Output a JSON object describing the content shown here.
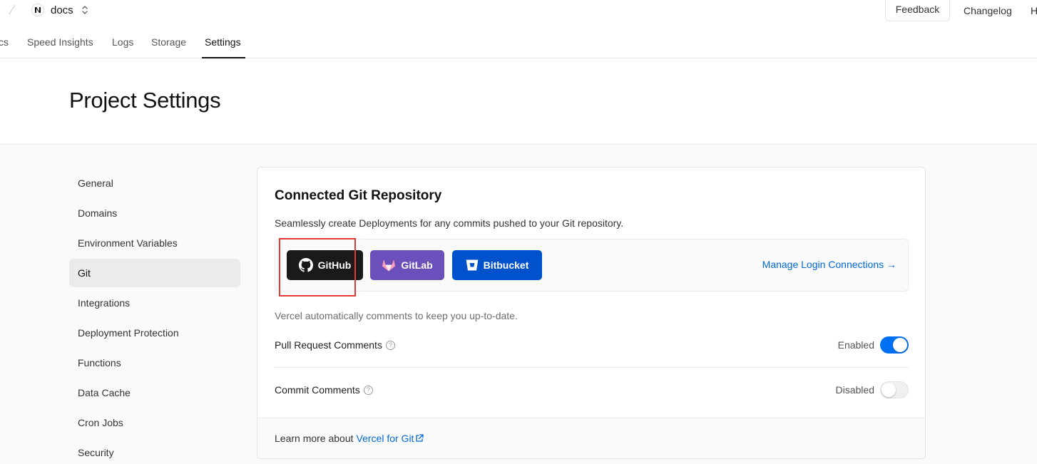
{
  "header": {
    "project_name": "docs",
    "feedback_label": "Feedback",
    "changelog_label": "Changelog",
    "cut_link_label": "H"
  },
  "tabs": [
    {
      "label": "cs",
      "active": false
    },
    {
      "label": "Speed Insights",
      "active": false
    },
    {
      "label": "Logs",
      "active": false
    },
    {
      "label": "Storage",
      "active": false
    },
    {
      "label": "Settings",
      "active": true
    }
  ],
  "page": {
    "title": "Project Settings"
  },
  "sidebar": {
    "items": [
      {
        "label": "General",
        "active": false
      },
      {
        "label": "Domains",
        "active": false
      },
      {
        "label": "Environment Variables",
        "active": false
      },
      {
        "label": "Git",
        "active": true
      },
      {
        "label": "Integrations",
        "active": false
      },
      {
        "label": "Deployment Protection",
        "active": false
      },
      {
        "label": "Functions",
        "active": false
      },
      {
        "label": "Data Cache",
        "active": false
      },
      {
        "label": "Cron Jobs",
        "active": false
      },
      {
        "label": "Security",
        "active": false
      }
    ]
  },
  "git_card": {
    "title": "Connected Git Repository",
    "description": "Seamlessly create Deployments for any commits pushed to your Git repository.",
    "providers": {
      "github": {
        "label": "GitHub",
        "color": "#1a1a1a"
      },
      "gitlab": {
        "label": "GitLab",
        "color": "#6b4fbb"
      },
      "bitbucket": {
        "label": "Bitbucket",
        "color": "#0052cc"
      }
    },
    "manage_link": "Manage Login Connections →",
    "auto_note": "Vercel automatically comments to keep you up-to-date.",
    "settings": [
      {
        "label": "Pull Request Comments",
        "status": "Enabled",
        "on": true
      },
      {
        "label": "Commit Comments",
        "status": "Disabled",
        "on": false
      }
    ],
    "footer_text": "Learn more about",
    "footer_link": "Vercel for Git"
  },
  "colors": {
    "accent": "#0070f3",
    "link": "#0068d6",
    "highlight": "#e53935"
  }
}
